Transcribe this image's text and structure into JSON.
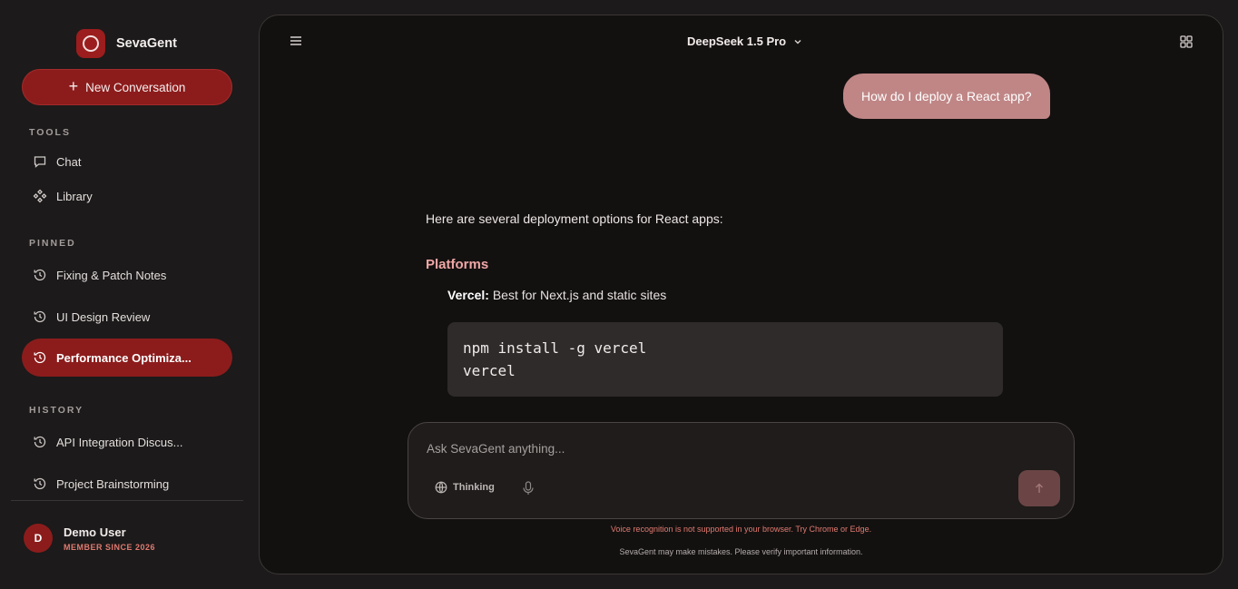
{
  "brand": {
    "name": "SevaGent"
  },
  "sidebar": {
    "new_conversation_label": "New Conversation",
    "tools_label": "TOOLS",
    "tools": [
      {
        "label": "Chat",
        "icon": "chat-icon"
      },
      {
        "label": "Library",
        "icon": "library-icon"
      }
    ],
    "pinned_label": "PINNED",
    "pinned": [
      {
        "label": "Fixing & Patch Notes",
        "icon": "history-icon",
        "active": false
      },
      {
        "label": "UI Design Review",
        "icon": "history-icon",
        "active": false
      },
      {
        "label": "Performance Optimiza...",
        "icon": "history-icon",
        "active": true
      }
    ],
    "history_label": "HISTORY",
    "history": [
      {
        "label": "API Integration Discus...",
        "icon": "history-icon"
      },
      {
        "label": "Project Brainstorming",
        "icon": "history-icon"
      }
    ],
    "user": {
      "initial": "D",
      "name": "Demo User",
      "subtitle": "MEMBER SINCE 2026"
    }
  },
  "header": {
    "model": "DeepSeek 1.5 Pro"
  },
  "conversation": {
    "user_message": "How do I deploy a React app?",
    "reply": {
      "intro": "Here are several deployment options for React apps:",
      "heading": "Platforms",
      "item_bold": "Vercel:",
      "item_text": " Best for Next.js and static sites",
      "code_lines": [
        "npm install -g vercel",
        "vercel"
      ]
    }
  },
  "composer": {
    "placeholder": "Ask SevaGent anything...",
    "thinking_label": "Thinking"
  },
  "notices": {
    "voice_warning": "Voice recognition is not supported in your browser. Try Chrome or Edge.",
    "disclaimer": "SevaGent may make mistakes. Please verify important information."
  },
  "colors": {
    "accent": "#8c1c1c",
    "user_bubble": "#c08686",
    "heading": "#f0a6a6",
    "warning": "#e07a70"
  }
}
